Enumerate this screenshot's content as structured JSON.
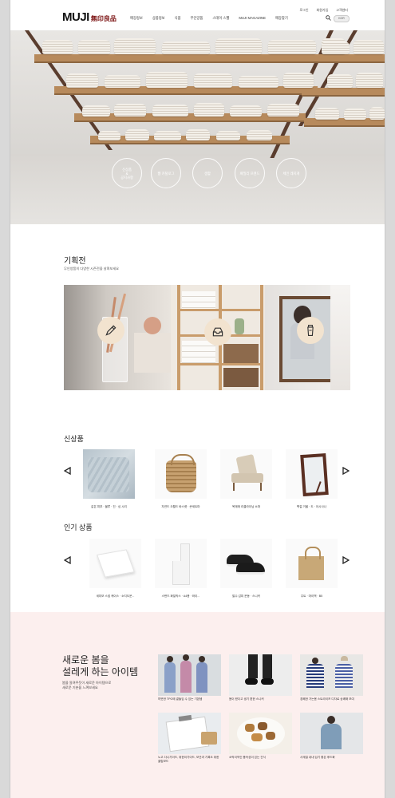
{
  "header": {
    "util_links": [
      "로그인",
      "회원가입",
      "고객센터"
    ],
    "logo_latin": "MUJI",
    "logo_kanji": "無印良品",
    "nav": [
      "매장정보",
      "상품정보",
      "식품",
      "무인양품",
      "스테이 스펠",
      "MUJI MAGAZINE",
      "매장찾기"
    ],
    "lang": "KOR"
  },
  "hero": {
    "circles": [
      "신상품\n&\n공지사항",
      "웹 카탈로그",
      "생활",
      "패밀리 프렌드",
      "체인 레지개"
    ]
  },
  "feature": {
    "title": "기획전",
    "subtitle": "무인양품의 다양한 시즌전을 살펴보세요"
  },
  "new_products": {
    "title": "신상품",
    "items": [
      "같은 피부 · 블루 · 진 · 싱 시리",
      "자연드 오월드 바스켓 · 큰세트마",
      "목재매 리클라이닝 소파",
      "벽걸 거울 · 도 · 아시사나"
    ]
  },
  "popular_products": {
    "title": "인기 상품",
    "items": [
      "세미모 스냅 케이스 · 소지도운...",
      "스탠드 화일박스 · A4용 · 와이...",
      "발수 갑피 운동 · 스니커",
      "주트 · 마이백 · B5"
    ]
  },
  "spring": {
    "title_line1": "새로운 봄을",
    "title_line2": "설레게 하는 아이템",
    "subtitle": "봄을 알려주듯이 새로운 아이템으로\n새로운 기분을 느껴보세요",
    "cards": [
      "따뜻한 TPO에 곁들임 수 있는 기본템",
      "봄이 왔다고 생기 편한 스니커",
      "경쾌한 가는봄 스트라이프 디자로 상쾌해 보여",
      "노고 다니가이드, 위한이가이드, 보관과 기록도 위한 클립보드",
      "소박이적인 풍속성이 있는 간식",
      "사계절 내내 입기 좋은 후드화"
    ]
  },
  "colors": {
    "accent_red": "#7a1010",
    "pink_bg": "#fcefee",
    "wood": "#b78a5c"
  }
}
